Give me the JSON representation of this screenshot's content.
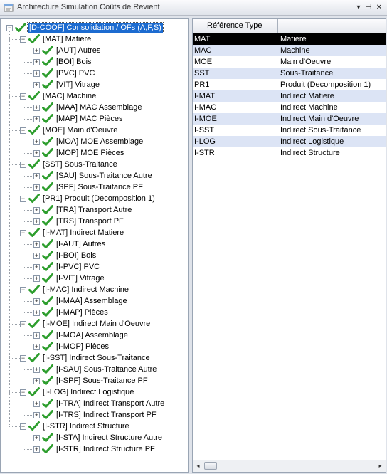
{
  "window": {
    "title": "Architecture Simulation Coûts de Revient",
    "buttons": [
      "▾",
      "⊣",
      "✕"
    ]
  },
  "tree": [
    {
      "label": "[D-COOF] Consolidation / OFs (A,F,S)",
      "level": 0,
      "expanded": true,
      "selected": true
    },
    {
      "label": "[MAT] Matiere",
      "level": 1,
      "expanded": true
    },
    {
      "label": "[AUT] Autres",
      "level": 2,
      "expanded": false
    },
    {
      "label": "[BOI] Bois",
      "level": 2,
      "expanded": false
    },
    {
      "label": "[PVC] PVC",
      "level": 2,
      "expanded": false
    },
    {
      "label": "[VIT] Vitrage",
      "level": 2,
      "expanded": false
    },
    {
      "label": "[MAC] Machine",
      "level": 1,
      "expanded": true
    },
    {
      "label": "[MAA] MAC Assemblage",
      "level": 2,
      "expanded": false
    },
    {
      "label": "[MAP] MAC Pièces",
      "level": 2,
      "expanded": false
    },
    {
      "label": "[MOE] Main d'Oeuvre",
      "level": 1,
      "expanded": true
    },
    {
      "label": "[MOA] MOE Assemblage",
      "level": 2,
      "expanded": false
    },
    {
      "label": "[MOP] MOE Pièces",
      "level": 2,
      "expanded": false
    },
    {
      "label": "[SST] Sous-Traitance",
      "level": 1,
      "expanded": true
    },
    {
      "label": "[SAU] Sous-Traitance Autre",
      "level": 2,
      "expanded": false
    },
    {
      "label": "[SPF] Sous-Traitance PF",
      "level": 2,
      "expanded": false
    },
    {
      "label": "[PR1] Produit (Decomposition 1)",
      "level": 1,
      "expanded": true
    },
    {
      "label": "[TRA] Transport Autre",
      "level": 2,
      "expanded": false
    },
    {
      "label": "[TRS] Transport PF",
      "level": 2,
      "expanded": false
    },
    {
      "label": "[I-MAT] Indirect Matiere",
      "level": 1,
      "expanded": true
    },
    {
      "label": "[I-AUT] Autres",
      "level": 2,
      "expanded": false
    },
    {
      "label": "[I-BOI] Bois",
      "level": 2,
      "expanded": false
    },
    {
      "label": "[I-PVC] PVC",
      "level": 2,
      "expanded": false
    },
    {
      "label": "[I-VIT] Vitrage",
      "level": 2,
      "expanded": false
    },
    {
      "label": "[I-MAC] Indirect Machine",
      "level": 1,
      "expanded": true
    },
    {
      "label": "[I-MAA] Assemblage",
      "level": 2,
      "expanded": false
    },
    {
      "label": "[I-MAP] Pièces",
      "level": 2,
      "expanded": false
    },
    {
      "label": "[I-MOE] Indirect Main d'Oeuvre",
      "level": 1,
      "expanded": true
    },
    {
      "label": "[I-MOA] Assemblage",
      "level": 2,
      "expanded": false
    },
    {
      "label": "[I-MOP] Pièces",
      "level": 2,
      "expanded": false
    },
    {
      "label": "[I-SST] Indirect Sous-Traitance",
      "level": 1,
      "expanded": true
    },
    {
      "label": "[I-SAU] Sous-Traitance Autre",
      "level": 2,
      "expanded": false
    },
    {
      "label": "[I-SPF] Sous-Traitance PF",
      "level": 2,
      "expanded": false
    },
    {
      "label": "[I-LOG] Indirect Logistique",
      "level": 1,
      "expanded": true
    },
    {
      "label": "[I-TRA] Indirect Transport Autre",
      "level": 2,
      "expanded": false
    },
    {
      "label": "[I-TRS] Indirect Transport PF",
      "level": 2,
      "expanded": false
    },
    {
      "label": "[I-STR] Indirect Structure",
      "level": 1,
      "expanded": true
    },
    {
      "label": "[I-STA] Indirect Structure Autre",
      "level": 2,
      "expanded": false
    },
    {
      "label": "[I-STR] Indirect Structure PF",
      "level": 2,
      "expanded": false
    }
  ],
  "grid": {
    "columns": [
      "Référence Type",
      ""
    ],
    "rows": [
      {
        "ref": "MAT",
        "type": "Matiere",
        "selected": true
      },
      {
        "ref": "MAC",
        "type": "Machine"
      },
      {
        "ref": "MOE",
        "type": "Main d'Oeuvre"
      },
      {
        "ref": "SST",
        "type": "Sous-Traitance"
      },
      {
        "ref": "PR1",
        "type": "Produit (Decomposition 1)"
      },
      {
        "ref": "I-MAT",
        "type": "Indirect Matiere"
      },
      {
        "ref": "I-MAC",
        "type": "Indirect Machine"
      },
      {
        "ref": "I-MOE",
        "type": "Indirect Main d'Oeuvre"
      },
      {
        "ref": "I-SST",
        "type": "Indirect Sous-Traitance"
      },
      {
        "ref": "I-LOG",
        "type": "Indirect Logistique"
      },
      {
        "ref": "I-STR",
        "type": "Indirect Structure"
      }
    ]
  },
  "scrollbar": {
    "left_arrow": "◂",
    "right_arrow": "▸"
  },
  "colors": {
    "selection": "#1c6bd0",
    "check": "#2e9e2e",
    "grid_alt_row": "#dce4f5"
  }
}
